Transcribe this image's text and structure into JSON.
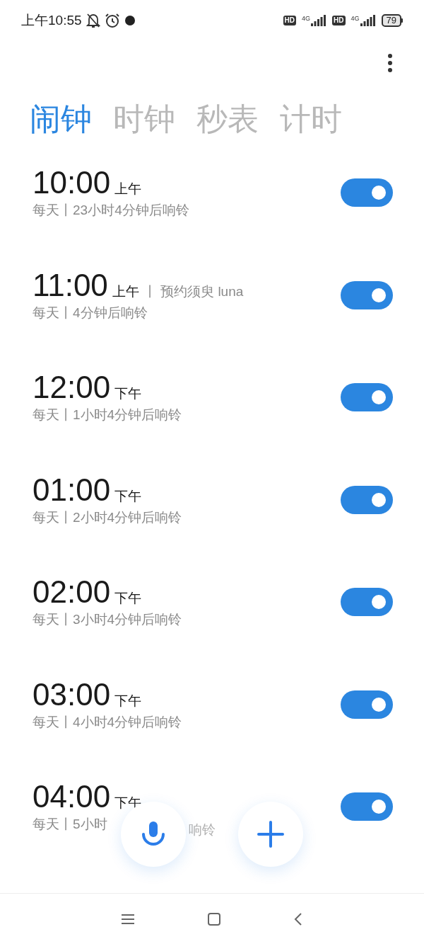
{
  "status_bar": {
    "time": "上午10:55",
    "sim_labels": [
      {
        "hd": "HD",
        "network": "4G"
      },
      {
        "hd": "HD",
        "network": "4G"
      }
    ],
    "battery": "79"
  },
  "tabs": [
    {
      "label": "闹钟",
      "selected": true
    },
    {
      "label": "时钟",
      "selected": false
    },
    {
      "label": "秒表",
      "selected": false
    },
    {
      "label": "计时",
      "selected": false
    }
  ],
  "alarms": [
    {
      "time": "10:00",
      "period": "上午",
      "note": "每天丨23小时4分钟后响铃",
      "on": true
    },
    {
      "time": "11:00",
      "period": "上午",
      "label": "丨 预约须臾 luna",
      "note": "每天丨4分钟后响铃",
      "on": true
    },
    {
      "time": "12:00",
      "period": "下午",
      "note": "每天丨1小时4分钟后响铃",
      "on": true
    },
    {
      "time": "01:00",
      "period": "下午",
      "note": "每天丨2小时4分钟后响铃",
      "on": true
    },
    {
      "time": "02:00",
      "period": "下午",
      "note": "每天丨3小时4分钟后响铃",
      "on": true
    },
    {
      "time": "03:00",
      "period": "下午",
      "note": "每天丨4小时4分钟后响铃",
      "on": true
    },
    {
      "time": "04:00",
      "period": "下午",
      "note": "每天丨5小时",
      "note_tail": "响铃",
      "on": true
    }
  ]
}
